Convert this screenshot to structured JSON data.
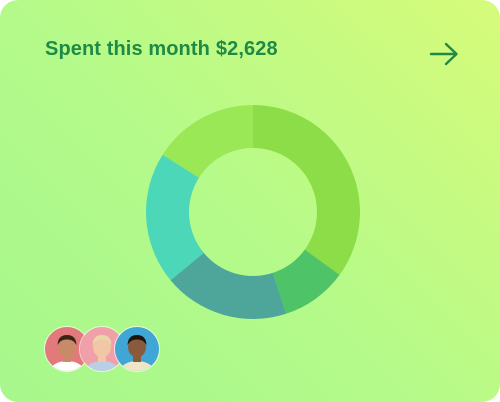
{
  "card": {
    "title_prefix": "Spent this month",
    "amount": "$2,628",
    "arrow_icon": "arrow-right-icon"
  },
  "colors": {
    "title": "#1f8a45",
    "arrow": "#1f8a45"
  },
  "spending_chart": {
    "type": "donut",
    "segments": [
      {
        "value": 0.35,
        "color": "#8cdd47"
      },
      {
        "value": 0.1,
        "color": "#4fc367"
      },
      {
        "value": 0.19,
        "color": "#4ea59a"
      },
      {
        "value": 0.2,
        "color": "#4cd8b8"
      },
      {
        "value": 0.16,
        "color": "#9be856"
      }
    ]
  },
  "avatars": [
    {
      "icon": "user-avatar",
      "bg": "#e27a7c",
      "skin": "#c98a6a",
      "hair": "#3a2418",
      "shirt": "#ffffff"
    },
    {
      "icon": "user-avatar",
      "bg": "#f0a0a8",
      "skin": "#f1c7a8",
      "hair": "#e9d7a8",
      "shirt": "#b8cfe6"
    },
    {
      "icon": "user-avatar",
      "bg": "#3fa6d6",
      "skin": "#8a5a3c",
      "hair": "#1c1410",
      "shirt": "#efe6c8"
    }
  ]
}
